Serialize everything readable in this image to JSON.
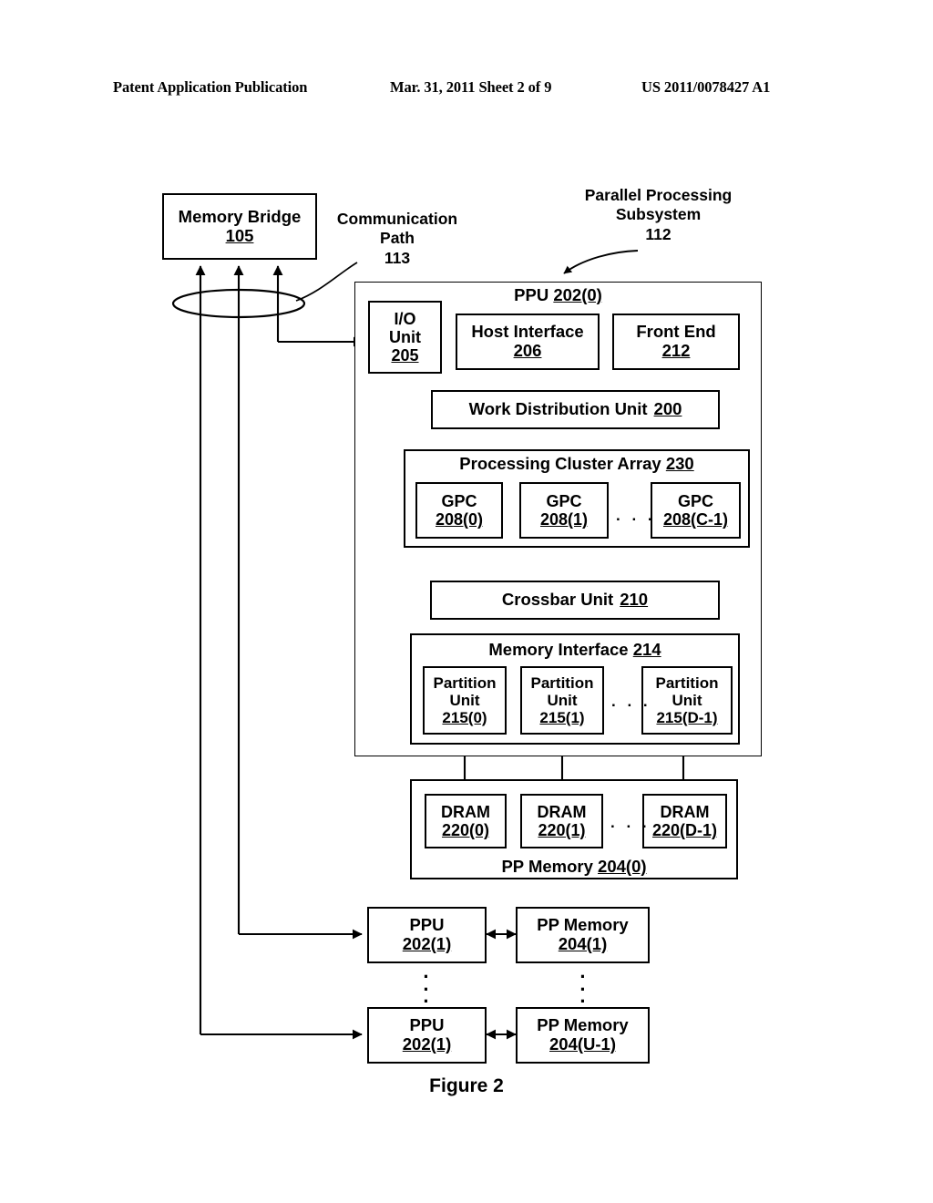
{
  "header": {
    "publication": "Patent Application Publication",
    "date_sheet": "Mar. 31, 2011  Sheet 2 of 9",
    "patent_number": "US 2011/0078427 A1"
  },
  "figure": {
    "caption": "Figure 2"
  },
  "annotations": {
    "communication_path": "Communication\nPath\n113",
    "communication_path_line1": "Communication",
    "communication_path_line2": "Path",
    "communication_path_ref": "113",
    "subsystem_line1": "Parallel Processing",
    "subsystem_line2": "Subsystem",
    "subsystem_ref": "112"
  },
  "blocks": {
    "memory_bridge": {
      "label": "Memory Bridge",
      "ref": "105"
    },
    "ppu0_title": {
      "label": "PPU",
      "ref": "202(0)"
    },
    "io_unit": {
      "line1": "I/O",
      "line2": "Unit",
      "ref": "205"
    },
    "host_interface": {
      "label": "Host Interface",
      "ref": "206"
    },
    "front_end": {
      "label": "Front End",
      "ref": "212"
    },
    "work_distribution_unit": {
      "label": "Work Distribution Unit",
      "ref": "200"
    },
    "processing_cluster_array": {
      "label": "Processing Cluster Array",
      "ref": "230"
    },
    "gpcs": [
      {
        "label": "GPC",
        "ref": "208(0)"
      },
      {
        "label": "GPC",
        "ref": "208(1)"
      },
      {
        "label": "GPC",
        "ref": "208(C-1)"
      }
    ],
    "gpc_ellipsis": ". . .",
    "crossbar_unit": {
      "label": "Crossbar Unit",
      "ref": "210"
    },
    "memory_interface": {
      "label": "Memory Interface",
      "ref": "214"
    },
    "partition_units": [
      {
        "line1": "Partition",
        "line2": "Unit",
        "ref": "215(0)"
      },
      {
        "line1": "Partition",
        "line2": "Unit",
        "ref": "215(1)"
      },
      {
        "line1": "Partition",
        "line2": "Unit",
        "ref": "215(D-1)"
      }
    ],
    "partition_ellipsis": ". . .",
    "pp_memory_0": {
      "label": "PP Memory",
      "ref": "204(0)"
    },
    "drams": [
      {
        "label": "DRAM",
        "ref": "220(0)"
      },
      {
        "label": "DRAM",
        "ref": "220(1)"
      },
      {
        "label": "DRAM",
        "ref": "220(D-1)"
      }
    ],
    "dram_ellipsis": ". . .",
    "ppu_1": {
      "label": "PPU",
      "ref": "202(1)"
    },
    "pp_memory_1": {
      "label": "PP Memory",
      "ref": "204(1)"
    },
    "ppu_u": {
      "label": "PPU",
      "ref": "202(1)"
    },
    "pp_memory_u": {
      "label": "PP Memory",
      "ref": "204(U-1)"
    },
    "vertical_ellipsis": "·\n·\n·"
  },
  "colors": {
    "ink": "#000000",
    "paper": "#ffffff"
  }
}
